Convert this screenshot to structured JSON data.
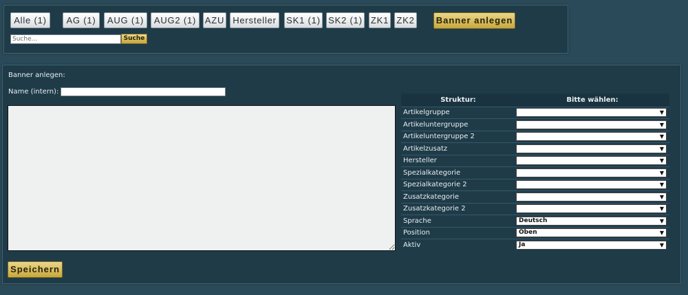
{
  "filter_bar": {
    "buttons": [
      {
        "label": "Alle (1)"
      },
      {
        "label": "AG (1)"
      },
      {
        "label": "AUG (1)"
      },
      {
        "label": "AUG2 (1)"
      },
      {
        "label": "AZU"
      },
      {
        "label": "Hersteller"
      },
      {
        "label": "SK1 (1)"
      },
      {
        "label": "SK2 (1)"
      },
      {
        "label": "ZK1"
      },
      {
        "label": "ZK2"
      }
    ],
    "create_banner_label": "Banner anlegen",
    "search": {
      "placeholder": "Suche...",
      "value": ""
    },
    "search_button_label": "Suche"
  },
  "form": {
    "title": "Banner anlegen:",
    "name_label": "Name (intern):",
    "name_value": "",
    "content_value": "",
    "save_label": "Speichern"
  },
  "structure": {
    "header_left": "Struktur:",
    "header_right": "Bitte wählen:",
    "rows": [
      {
        "label": "Artikelgruppe",
        "selected": ""
      },
      {
        "label": "Artikeluntergruppe",
        "selected": ""
      },
      {
        "label": "Artikeluntergruppe 2",
        "selected": ""
      },
      {
        "label": "Artikelzusatz",
        "selected": ""
      },
      {
        "label": "Hersteller",
        "selected": ""
      },
      {
        "label": "Spezialkategorie",
        "selected": ""
      },
      {
        "label": "Spezialkategorie 2",
        "selected": ""
      },
      {
        "label": "Zusatzkategorie",
        "selected": ""
      },
      {
        "label": "Zusatzkategorie 2",
        "selected": ""
      },
      {
        "label": "Sprache",
        "selected": "Deutsch"
      },
      {
        "label": "Position",
        "selected": "Oben"
      },
      {
        "label": "Aktiv",
        "selected": "Ja"
      }
    ],
    "arrow_icon": "dropdown-arrow-icon"
  },
  "colors": {
    "background": "#2b4a59",
    "panel": "#1f3b48",
    "gold_button": "#c8a83c"
  }
}
